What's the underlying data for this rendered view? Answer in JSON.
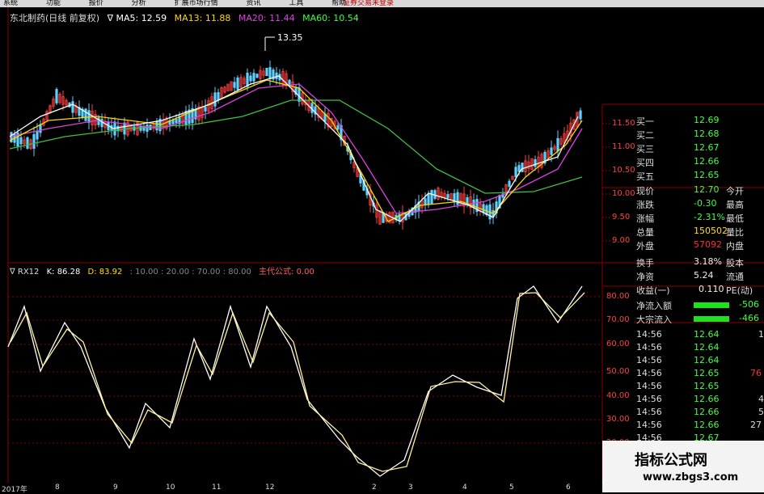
{
  "menu": {
    "items": [
      "系统",
      "功能",
      "报价",
      "分析",
      "扩展市场行情",
      "资讯",
      "工具",
      "帮助"
    ],
    "alert": "证券交易未登录"
  },
  "chart_header": {
    "name": "东北制药(日线 前复权)",
    "ma5": "∇ MA5: 12.59",
    "ma13": "MA13: 11.88",
    "ma20": "MA20: 11.44",
    "ma60": "MA60: 10.54",
    "high_marker": "13.35"
  },
  "indicator_header": {
    "name": "∇ RX12",
    "k": "K: 86.28",
    "d": "D: 83.92",
    "levels": ": 10.00 : 20.00 : 70.00 : 80.00",
    "formula": "主代公式: 0.00"
  },
  "price_axis": [
    "11.50",
    "11.00",
    "10.50",
    "10.00",
    "9.50",
    "9.00"
  ],
  "indicator_axis": [
    "80.00",
    "70.00",
    "60.00",
    "50.00",
    "40.00",
    "30.00",
    "20.00"
  ],
  "date_axis": [
    "2017年",
    "8",
    "9",
    "10",
    "11",
    "12",
    "2",
    "3",
    "4",
    "5",
    "6"
  ],
  "quote": {
    "rows": [
      {
        "label": "买一",
        "value": "12.69",
        "color": "green",
        "extra": ""
      },
      {
        "label": "买二",
        "value": "12.68",
        "color": "green",
        "extra": ""
      },
      {
        "label": "买三",
        "value": "12.67",
        "color": "green",
        "extra": ""
      },
      {
        "label": "买四",
        "value": "12.66",
        "color": "green",
        "extra": ""
      },
      {
        "label": "买五",
        "value": "12.65",
        "color": "green",
        "extra": ""
      },
      {
        "label": "现价",
        "value": "12.70",
        "color": "green",
        "extra": "今开"
      },
      {
        "label": "涨跌",
        "value": "-0.30",
        "color": "green",
        "extra": "最高"
      },
      {
        "label": "涨幅",
        "value": "-2.31%",
        "color": "green",
        "extra": "最低"
      },
      {
        "label": "总量",
        "value": "150502",
        "color": "yellow",
        "extra": "量比"
      },
      {
        "label": "外盘",
        "value": "57092",
        "color": "red",
        "extra": "内盘"
      },
      {
        "label": "换手",
        "value": "3.18%",
        "color": "white",
        "extra": "股本"
      },
      {
        "label": "净资",
        "value": "5.24",
        "color": "white",
        "extra": "流通"
      },
      {
        "label": "收益(一)",
        "value": "0.110",
        "color": "white",
        "extra": "PE(动)"
      }
    ],
    "flows": [
      {
        "label": "净流入额",
        "value": "-506"
      },
      {
        "label": "大宗流入",
        "value": "-466"
      }
    ],
    "ticks": [
      {
        "time": "14:56",
        "price": "12.64",
        "vol": "1"
      },
      {
        "time": "14:56",
        "price": "12.64",
        "vol": ""
      },
      {
        "time": "14:56",
        "price": "12.64",
        "vol": ""
      },
      {
        "time": "14:56",
        "price": "12.65",
        "vol": "76"
      },
      {
        "time": "14:56",
        "price": "12.65",
        "vol": ""
      },
      {
        "time": "14:56",
        "price": "12.66",
        "vol": "4"
      },
      {
        "time": "14:56",
        "price": "12.66",
        "vol": "5"
      },
      {
        "time": "14:56",
        "price": "12.66",
        "vol": "27"
      },
      {
        "time": "14:56",
        "price": "12.67",
        "vol": ""
      }
    ]
  },
  "watermark": {
    "title": "指标公式网",
    "url": "www.zbgs3.com"
  }
}
